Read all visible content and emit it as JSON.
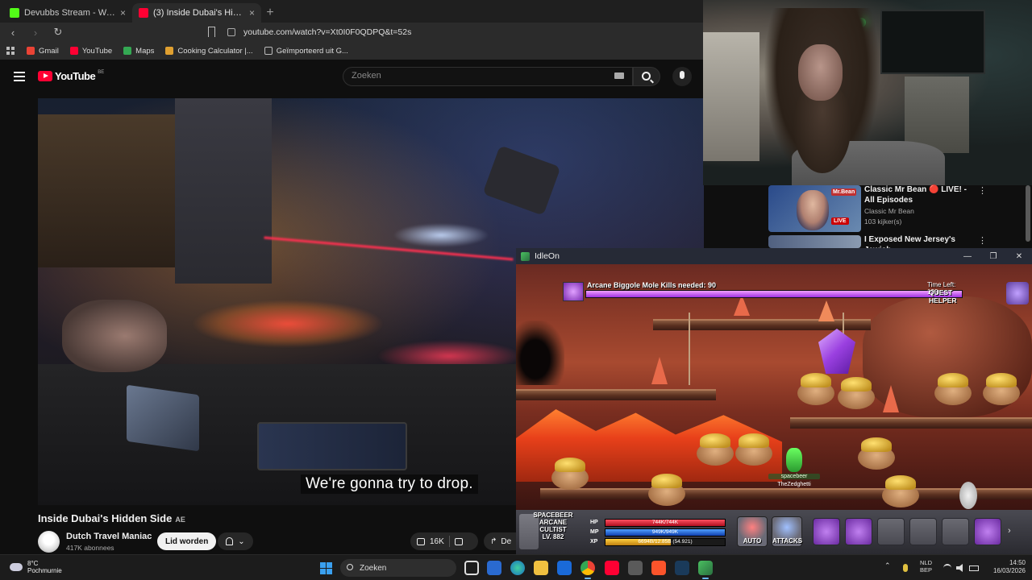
{
  "browser": {
    "tabs": [
      {
        "label": "Devubbs Stream - Watch Live on",
        "active": false,
        "favicon_color": "#53fc18"
      },
      {
        "label": "(3) Inside Dubai's Hidden Side",
        "active": true,
        "favicon_color": "#ff0033"
      }
    ],
    "new_tab": "+",
    "url": "youtube.com/watch?v=Xt0I0F0QDPQ&t=52s",
    "bookmarks": [
      {
        "label": "Gmail",
        "color": "#ea4335"
      },
      {
        "label": "YouTube",
        "color": "#ff0033"
      },
      {
        "label": "Maps",
        "color": "#34a853"
      },
      {
        "label": "Cooking Calculator |...",
        "color": "#e0a030"
      },
      {
        "label": "Geïmporteerd uit G...",
        "color": "#bbbbbb"
      }
    ]
  },
  "youtube": {
    "logo_text": "YouTube",
    "country_code": "BE",
    "search_placeholder": "Zoeken",
    "video": {
      "caption": "We're gonna try to drop.",
      "title": "Inside Dubai's Hidden Side",
      "title_badge": "AE",
      "channel": "Dutch Travel Maniac",
      "subscribers": "417K abonnees",
      "join_label": "Lid worden",
      "likes": "16K",
      "share_label": "De"
    },
    "recommendations": [
      {
        "title": "Classic Mr Bean 🔴 LIVE! - All Episodes",
        "channel": "Classic Mr Bean",
        "views": "103 kijker(s)",
        "live_badge": "LIVE",
        "logo": "Mr.Bean"
      },
      {
        "title": "I Exposed New Jersey's Jewish",
        "channel": "",
        "views": "",
        "live_badge": "",
        "logo": ""
      }
    ]
  },
  "game": {
    "window_title": "IdleOn",
    "boss_label": "Arcane Biggole Mole Kills needed: 90",
    "boss_progress": 1.0,
    "time_left": "Time Left: 193",
    "quest_helper": "QUEST HELPER",
    "quest_plus": "(+)",
    "player_name": "spacebeer",
    "player_name2": "TheZedghetti",
    "character": {
      "line1": "SPACEBEER",
      "line2": "ARCANE",
      "line3": "CULTIST",
      "level": "LV. 882"
    },
    "stats": {
      "hp": {
        "label": "HP",
        "text": "744K/744K",
        "fraction": 1.0
      },
      "mp": {
        "label": "MP",
        "text": "949K/949K",
        "fraction": 1.0
      },
      "xp": {
        "label": "XP",
        "text": "6694B/12.85B (54.921)",
        "fraction": 0.55
      }
    },
    "buttons": {
      "auto": "AUTO",
      "attacks": "ATTACKS"
    }
  },
  "taskbar": {
    "weather_temp": "8°C",
    "weather_desc": "Pochmurnie",
    "search_label": "Zoeken",
    "lang1": "NLD",
    "lang2": "BEP",
    "time": "14:50",
    "date": "16/03/2026"
  }
}
